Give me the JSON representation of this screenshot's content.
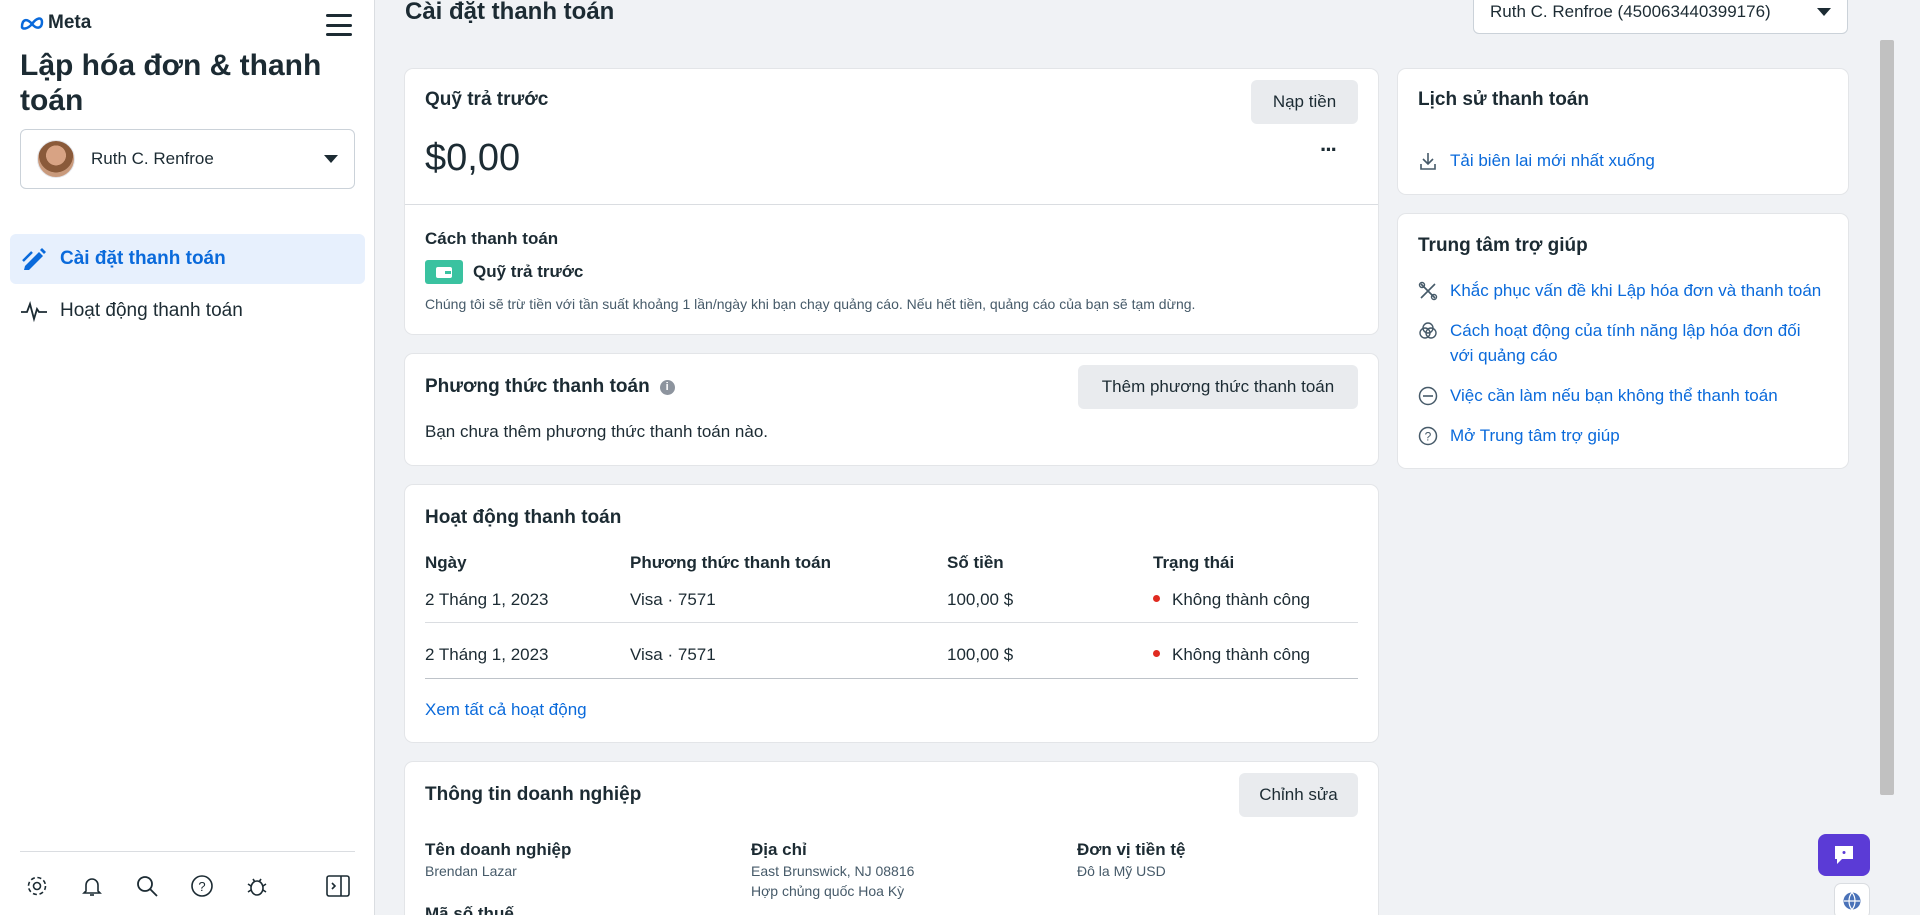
{
  "sidebar": {
    "logo_text": "Meta",
    "title": "Lập hóa đơn & thanh toán",
    "account_name": "Ruth C. Renfroe",
    "nav": [
      {
        "label": "Cài đặt thanh toán",
        "icon": "pencil-icon",
        "active": true
      },
      {
        "label": "Hoạt động thanh toán",
        "icon": "pulse-icon",
        "active": false
      }
    ],
    "footer_icons": [
      "gear-icon",
      "bell-icon",
      "search-icon",
      "help-icon",
      "bug-icon"
    ],
    "footer_right_icon": "sidebar-toggle-icon"
  },
  "header": {
    "page_title": "Cài đặt thanh toán",
    "account_dropdown": "Ruth C. Renfroe (450063440399176)"
  },
  "prepaid": {
    "title": "Quỹ trả trước",
    "topup_label": "Nạp tiền",
    "balance": "$0,00",
    "more": "···",
    "method_heading": "Cách thanh toán",
    "method_name": "Quỹ trả trước",
    "note": "Chúng tôi sẽ trừ tiền với tần suất khoảng 1 lần/ngày khi bạn chạy quảng cáo. Nếu hết tiền, quảng cáo của bạn sẽ tạm dừng."
  },
  "payment_methods": {
    "title": "Phương thức thanh toán",
    "add_label": "Thêm phương thức thanh toán",
    "empty": "Bạn chưa thêm phương thức thanh toán nào."
  },
  "activity": {
    "title": "Hoạt động thanh toán",
    "columns": [
      "Ngày",
      "Phương thức thanh toán",
      "Số tiền",
      "Trạng thái"
    ],
    "rows": [
      {
        "date": "2 Tháng 1, 2023",
        "method": "Visa · 7571",
        "amount": "100,00 $",
        "status": "Không thành công"
      },
      {
        "date": "2 Tháng 1, 2023",
        "method": "Visa · 7571",
        "amount": "100,00 $",
        "status": "Không thành công"
      }
    ],
    "view_all": "Xem tất cả hoạt động",
    "status_color": "#e02b20"
  },
  "business": {
    "title": "Thông tin doanh nghiệp",
    "edit_label": "Chỉnh sửa",
    "name_label": "Tên doanh nghiệp",
    "name_value": "Brendan Lazar",
    "address_label": "Địa chỉ",
    "address_line1": "East Brunswick, NJ 08816",
    "address_line2": "Hợp chủng quốc Hoa Kỳ",
    "currency_label": "Đơn vị tiền tệ",
    "currency_value": "Đô la Mỹ USD",
    "tax_label": "Mã số thuế"
  },
  "history": {
    "title": "Lịch sử thanh toán",
    "download_label": "Tải biên lai mới nhất xuống"
  },
  "help": {
    "title": "Trung tâm trợ giúp",
    "links": [
      {
        "label": "Khắc phục vấn đề khi Lập hóa đơn và thanh toán",
        "icon": "tools-icon"
      },
      {
        "label": "Cách hoạt động của tính năng lập hóa đơn đối với quảng cáo",
        "icon": "circles-icon"
      },
      {
        "label": "Việc cần làm nếu bạn không thể thanh toán",
        "icon": "minus-circle-icon"
      },
      {
        "label": "Mở Trung tâm trợ giúp",
        "icon": "question-circle-icon"
      }
    ]
  },
  "colors": {
    "accent": "#0a6adb",
    "chat": "#5b3bd6",
    "prepaid_badge": "#3ac2a0"
  }
}
